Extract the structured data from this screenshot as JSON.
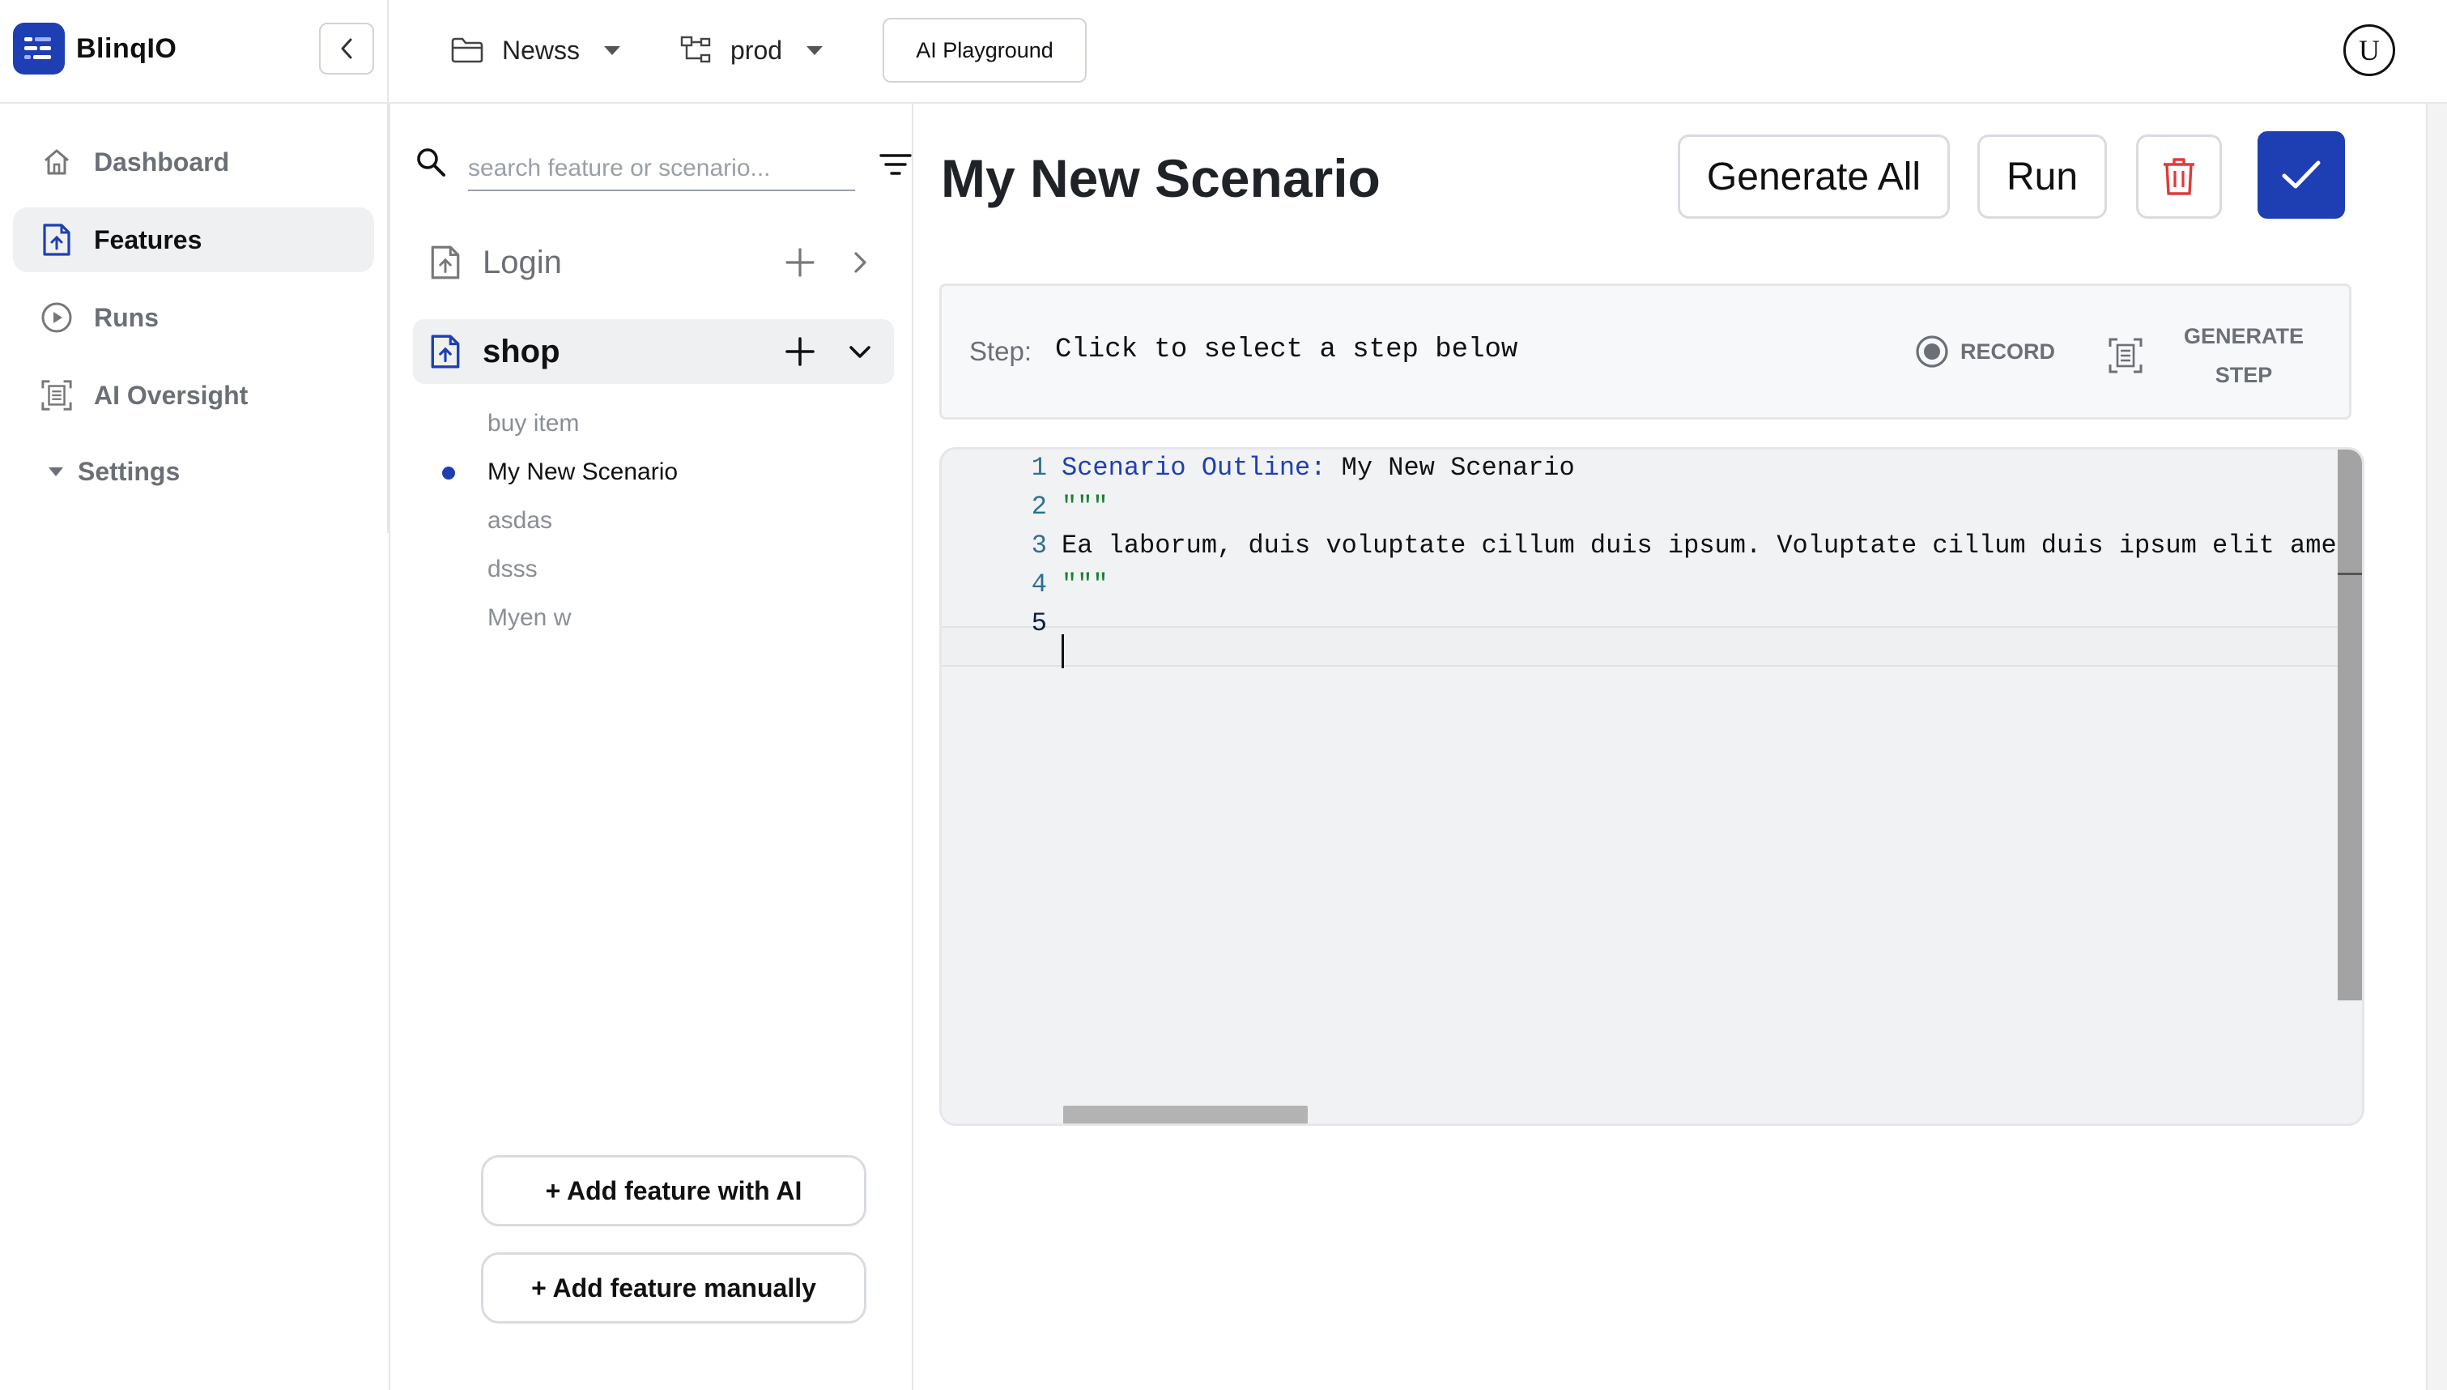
{
  "app": {
    "name": "BlinqIO"
  },
  "topbar": {
    "project": "Newss",
    "environment": "prod",
    "playground_label": "AI Playground",
    "avatar_initial": "U"
  },
  "nav": {
    "items": [
      {
        "label": "Dashboard",
        "icon": "home-icon"
      },
      {
        "label": "Features",
        "icon": "feature-file-icon",
        "active": true
      },
      {
        "label": "Runs",
        "icon": "play-circle-icon"
      },
      {
        "label": "AI Oversight",
        "icon": "scan-icon"
      }
    ],
    "settings_label": "Settings"
  },
  "features": {
    "search_placeholder": "search feature or scenario...",
    "list": [
      {
        "name": "Login",
        "expanded": false
      },
      {
        "name": "shop",
        "expanded": true,
        "scenarios": [
          "buy item",
          "My New Scenario",
          "asdas",
          "dsss",
          "Myen w"
        ]
      }
    ],
    "add_with_ai": "+ Add feature with AI",
    "add_manually": "+ Add feature manually"
  },
  "main": {
    "title": "My New Scenario",
    "generate_all": "Generate All",
    "run": "Run",
    "step_label": "Step:",
    "step_value": "Click to select a step below",
    "record_label": "RECORD",
    "generate_step_line1": "GENERATE",
    "generate_step_line2": "STEP"
  },
  "editor": {
    "lines": [
      {
        "num": "1",
        "keyword": "Scenario Outline:",
        "text": " My New Scenario"
      },
      {
        "num": "2",
        "text": "\"\"\""
      },
      {
        "num": "3",
        "text": "Ea laborum, duis voluptate cillum duis ipsum. Voluptate cillum duis ipsum elit amet"
      },
      {
        "num": "4",
        "text": "\"\"\""
      },
      {
        "num": "5",
        "text": ""
      }
    ]
  },
  "colors": {
    "accent": "#1e3fb3",
    "danger": "#e03a3a",
    "muted": "#6b6f76"
  }
}
